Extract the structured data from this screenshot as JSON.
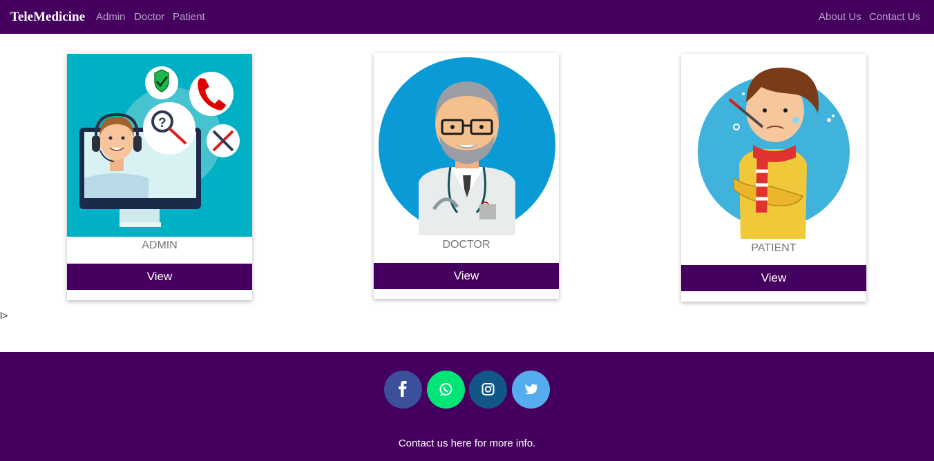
{
  "navbar": {
    "brand": "TeleMedicine",
    "links": [
      "Admin",
      "Doctor",
      "Patient"
    ],
    "right_links": [
      "About Us",
      "Contact Us"
    ]
  },
  "cards": [
    {
      "title": "ADMIN",
      "button": "View",
      "image": "admin-support-illustration"
    },
    {
      "title": "DOCTOR",
      "button": "View",
      "image": "doctor-avatar-illustration"
    },
    {
      "title": "PATIENT",
      "button": "View",
      "image": "sick-patient-illustration"
    }
  ],
  "stray_text": "l>",
  "footer": {
    "social": [
      {
        "icon": "facebook-icon",
        "color": "#3b4f9c"
      },
      {
        "icon": "whatsapp-icon",
        "color": "#00e676"
      },
      {
        "icon": "instagram-icon",
        "color": "#125688"
      },
      {
        "icon": "twitter-icon",
        "color": "#55acee"
      }
    ],
    "text": "Contact us here for more info."
  },
  "colors": {
    "primary": "#45005f",
    "nav_link": "#b9a3c8"
  }
}
